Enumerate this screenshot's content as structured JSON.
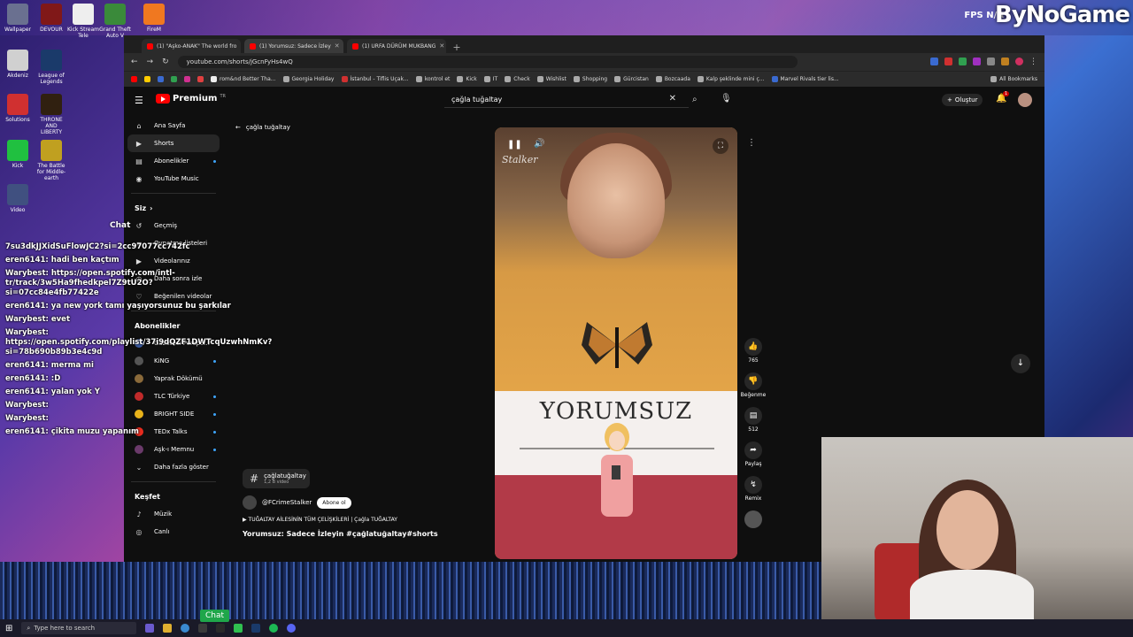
{
  "brand": "ByNoGame",
  "fps": "FPS  N/A",
  "desktop_icons": [
    "Wallpaper",
    "DEVOUR",
    "Kick Stream Tele",
    "Grand Theft Auto V",
    "FireM",
    "Akdeniz",
    "League of Legends",
    "Solutions",
    "THRONE AND LIBERTY",
    "Kick",
    "The Battle for Middle-earth",
    "Video"
  ],
  "tabs": [
    {
      "label": "(1) \"Aşko-ANAK\" The world fro",
      "active": false
    },
    {
      "label": "(1) Yorumsuz: Sadece İzley",
      "active": true
    },
    {
      "label": "(1) URFA DÜRÜM MUKBANG",
      "active": false
    }
  ],
  "url": "youtube.com/shorts/jGcnFyHs4wQ",
  "bookmarks": [
    "rom&nd Better Tha...",
    "Georgia Holiday",
    "İstanbul - Tiflis Uçak...",
    "kontrol et",
    "Kick",
    "IT",
    "Check",
    "Wishlist",
    "Shopping",
    "Gürcistan",
    "Bozcaada",
    "Kalp şeklinde mini ç...",
    "Marvel Rivals tier lis...",
    "All Bookmarks"
  ],
  "yt": {
    "logo": "Premium",
    "logo_tm": "TR",
    "search_value": "çağla tuğaltay",
    "create": "Oluştur",
    "bell_count": "1"
  },
  "sidebar": {
    "main": [
      {
        "label": "Ana Sayfa",
        "icon": "home-icon",
        "glyph": "⌂",
        "active": false
      },
      {
        "label": "Shorts",
        "icon": "shorts-icon",
        "glyph": "▶",
        "active": true
      },
      {
        "label": "Abonelikler",
        "icon": "subscriptions-icon",
        "glyph": "▤",
        "active": false
      },
      {
        "label": "YouTube Music",
        "icon": "music-icon",
        "glyph": "◉",
        "active": false
      }
    ],
    "you_header": "Siz",
    "you": [
      {
        "label": "Geçmiş",
        "icon": "history-icon",
        "glyph": "↺"
      },
      {
        "label": "Oynatma listeleri",
        "icon": "playlist-icon",
        "glyph": "≡"
      },
      {
        "label": "Videolarınız",
        "icon": "your-videos-icon",
        "glyph": "▶"
      },
      {
        "label": "Daha sonra izle",
        "icon": "watch-later-icon",
        "glyph": "◷"
      },
      {
        "label": "Beğenilen videolar",
        "icon": "liked-icon",
        "glyph": "👍"
      }
    ],
    "subs_header": "Abonelikler",
    "subs": [
      {
        "label": "Gazeteci Perspe...",
        "color": "#3a5aa0"
      },
      {
        "label": "KiNG",
        "color": "#1e1e1e"
      },
      {
        "label": "Yaprak Dökümü",
        "color": "#8a6a3a"
      },
      {
        "label": "TLC Türkiye",
        "color": "#c02a2a"
      },
      {
        "label": "BRIGHT SIDE",
        "color": "#e8b21a"
      },
      {
        "label": "TEDx Talks",
        "color": "#e62b1e"
      },
      {
        "label": "Aşk-ı Memnu",
        "color": "#6a3a6a"
      }
    ],
    "more": "Daha fazla göster",
    "explore_header": "Keşfet",
    "explore": [
      {
        "label": "Müzik",
        "icon": "music-note-icon",
        "glyph": "♪"
      },
      {
        "label": "Canlı",
        "icon": "live-icon",
        "glyph": "◎"
      }
    ]
  },
  "back_label": "çağla tuğaltay",
  "video": {
    "overlay_text": "YORUMSUZ",
    "watermark": "Stalker"
  },
  "actions": {
    "likes": "765",
    "dislike": "Beğenme",
    "comments": "512",
    "share": "Paylaş",
    "remix": "Remix"
  },
  "info": {
    "hashtag": "çağlatuğaltay",
    "hashtag_count": "1,2 B video",
    "channel": "@FCrimeStalker",
    "subscribe": "Abone ol",
    "description": "TUĞALTAY AİLESİNİN TÜM ÇELİŞKİLERİ | Çağla TUĞALTAY",
    "title": "Yorumsuz: Sadece İzleyin #çağlatuğaltay#shorts"
  },
  "chat": {
    "header": "Chat",
    "lines": [
      "7su3dkJJXidSuFlowJC2?si=2cc97077cc742fc",
      "eren6141: hadi ben kaçtım",
      "Warybest: https://open.spotify.com/intl-tr/track/3w5Ha9fhedkpel7Z9tU2O?si=07cc84e4fb77422e",
      "eren6141: ya new york tamı yaşıyorsunuz bu şarkılar",
      "Warybest: evet",
      "Warybest: https://open.spotify.com/playlist/37i9dQZF1DWTcqUzwhNmKv?si=78b690b89b3e4c9d",
      "eren6141: merma mi",
      "eren6141: :D",
      "eren6141: yalan yok Y",
      "Warybest:",
      "Warybest:",
      "eren6141: çikita muzu yapanım"
    ]
  },
  "taskbar": {
    "search_placeholder": "Type here to search",
    "chat_btn": "Chat"
  }
}
